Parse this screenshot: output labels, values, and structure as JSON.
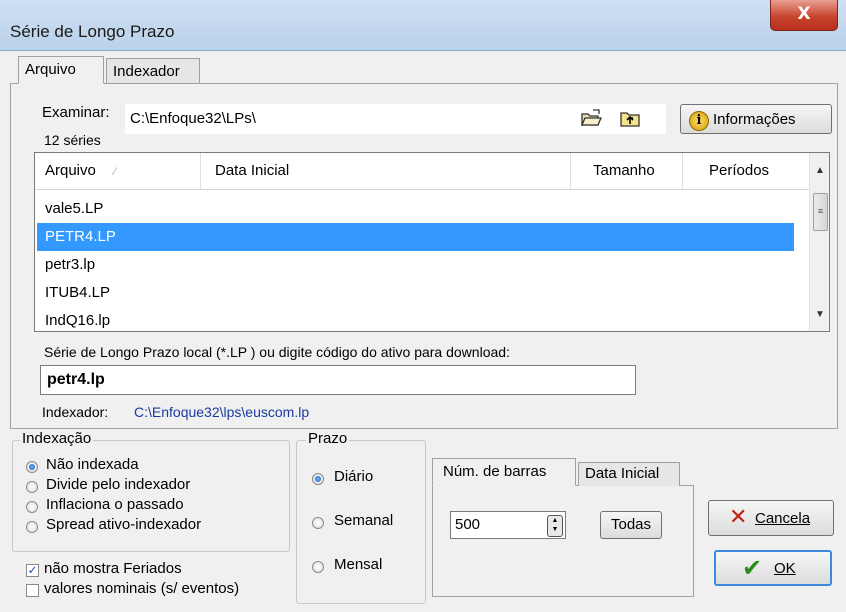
{
  "window": {
    "title": "Série de Longo Prazo",
    "close_glyph": "X"
  },
  "tabs": [
    {
      "label": "Arquivo"
    },
    {
      "label": "Indexador"
    }
  ],
  "browse": {
    "label": "Examinar:",
    "path": "C:\\Enfoque32\\LPs\\",
    "count": "12 séries",
    "info_button": "Informações"
  },
  "list": {
    "columns": [
      "Arquivo",
      "Data Inicial",
      "Tamanho",
      "Períodos"
    ],
    "rows": [
      "vale5.LP",
      "PETR4.LP",
      "petr3.lp",
      "ITUB4.LP",
      "IndQ16.lp"
    ],
    "selected_index": 1
  },
  "download": {
    "label": "Série de Longo Prazo local (*.LP )  ou digite código do ativo  para download:",
    "value": "petr4.lp"
  },
  "indexador": {
    "label": "Indexador:",
    "path": "C:\\Enfoque32\\lps\\euscom.lp"
  },
  "indexacao": {
    "title": "Indexação",
    "options": [
      "Não indexada",
      "Divide pelo indexador",
      "Inflaciona o passado",
      "Spread ativo-indexador"
    ],
    "selected_index": 0
  },
  "checks": [
    {
      "label": "não mostra Feriados",
      "checked": true
    },
    {
      "label": "valores nominais (s/ eventos)",
      "checked": false
    }
  ],
  "prazo": {
    "title": "Prazo",
    "options": [
      "Diário",
      "Semanal",
      "Mensal"
    ],
    "selected_index": 0
  },
  "barras": {
    "tabs": [
      "Núm. de barras",
      "Data Inicial"
    ],
    "value": "500",
    "todas_button": "Todas"
  },
  "actions": {
    "cancel": "Cancela",
    "ok": "OK"
  },
  "colors": {
    "selection": "#3399ff",
    "link": "#1a3aa0",
    "ok_green": "#2a8a1a",
    "cancel_red": "#c0201a"
  }
}
